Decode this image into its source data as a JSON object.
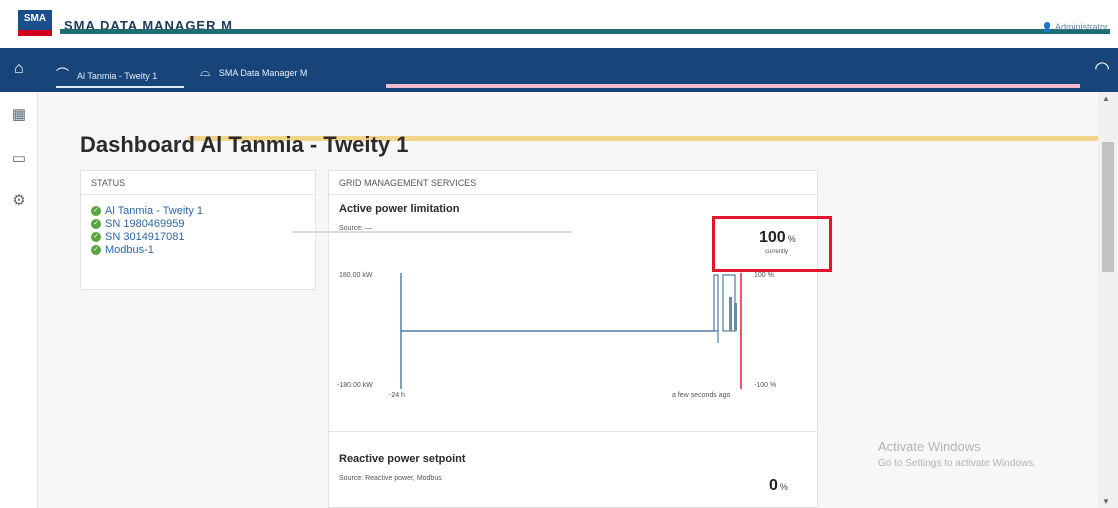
{
  "header": {
    "logo_text": "SMA",
    "app_title": "SMA DATA MANAGER M",
    "user_text": "Administrator"
  },
  "nav": {
    "items": [
      {
        "label": "Al Tanmia - Tweity 1",
        "icon": "plant-icon"
      },
      {
        "label": "SMA Data Manager M",
        "icon": "device-icon"
      }
    ]
  },
  "page": {
    "title": "Dashboard Al Tanmia - Tweity 1"
  },
  "status": {
    "header": "STATUS",
    "items": [
      "Al Tanmia - Tweity 1",
      "SN 1980469959",
      "SN 3014917081",
      "Modbus-1"
    ]
  },
  "grid": {
    "header": "GRID MANAGEMENT SERVICES",
    "active": {
      "title": "Active power limitation",
      "source": "Source: —",
      "value": "100",
      "unit": "%",
      "sub": "currently",
      "y_top": "180.00 kW",
      "y_bottom": "-180.00 kW",
      "pct_top": "100 %",
      "pct_bottom": "-100 %",
      "x_left": "-24 h",
      "x_right": "a few seconds ago"
    },
    "reactive": {
      "title": "Reactive power setpoint",
      "source": "Source: Reactive power, Modbus",
      "value": "0",
      "unit": "%"
    }
  },
  "watermark": {
    "line1": "Activate Windows",
    "line2": "Go to Settings to activate Windows."
  },
  "colors": {
    "brand_blue": "#17457a",
    "status_ok": "#57a53f",
    "highlight_red": "#e2152b"
  }
}
